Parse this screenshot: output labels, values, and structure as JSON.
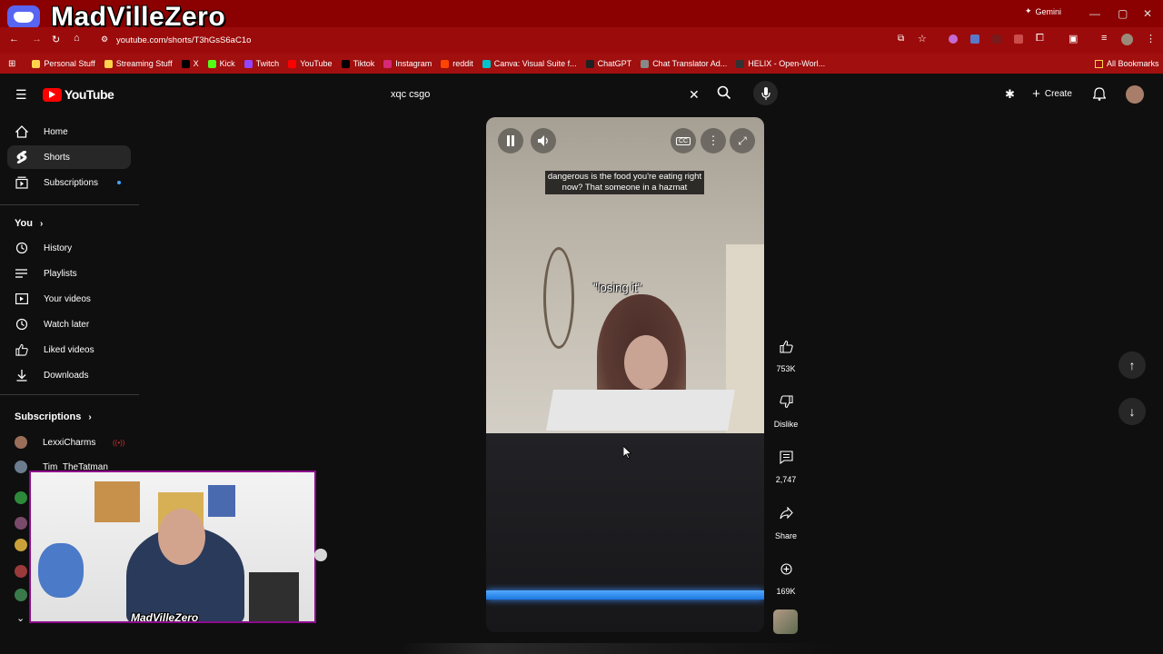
{
  "overlay": {
    "title": "MadVilleZero",
    "webcam_name": "MadVilleZero"
  },
  "browser": {
    "url": "youtube.com/shorts/T3hGsS6aC1o",
    "tab_hint": "bifr",
    "gemini_label": "Gemini",
    "bookmarks": [
      {
        "label": "Personal Stuff",
        "color": "#ffd44d"
      },
      {
        "label": "Streaming Stuff",
        "color": "#ffd44d"
      },
      {
        "label": "X",
        "color": "#000000"
      },
      {
        "label": "Kick",
        "color": "#53fc18"
      },
      {
        "label": "Twitch",
        "color": "#9146ff"
      },
      {
        "label": "YouTube",
        "color": "#ff0000"
      },
      {
        "label": "Tiktok",
        "color": "#000000"
      },
      {
        "label": "Instagram",
        "color": "#d62976"
      },
      {
        "label": "reddit",
        "color": "#ff4500"
      },
      {
        "label": "Canva: Visual Suite f...",
        "color": "#00c4cc"
      },
      {
        "label": "ChatGPT",
        "color": "#202123"
      },
      {
        "label": "Chat Translator Ad...",
        "color": "#888888"
      },
      {
        "label": "HELIX - Open-Worl...",
        "color": "#333333"
      }
    ],
    "all_bookmarks": "All Bookmarks"
  },
  "youtube": {
    "logo": "YouTube",
    "search": {
      "value": "xqc csgo"
    },
    "create_label": "Create",
    "sidebar": {
      "main": [
        {
          "label": "Home",
          "icon": "home-icon"
        },
        {
          "label": "Shorts",
          "icon": "shorts-icon"
        },
        {
          "label": "Subscriptions",
          "icon": "subscriptions-icon"
        }
      ],
      "you_heading": "You",
      "you": [
        {
          "label": "History",
          "icon": "history-icon"
        },
        {
          "label": "Playlists",
          "icon": "playlists-icon"
        },
        {
          "label": "Your videos",
          "icon": "your-videos-icon"
        },
        {
          "label": "Watch later",
          "icon": "watch-later-icon"
        },
        {
          "label": "Liked videos",
          "icon": "liked-videos-icon"
        },
        {
          "label": "Downloads",
          "icon": "downloads-icon"
        }
      ],
      "subscriptions_heading": "Subscriptions",
      "subscriptions": [
        {
          "label": "LexxiCharms",
          "color": "#9b6e5a"
        },
        {
          "label": "Tim_TheTatman",
          "color": "#6b7c8e"
        }
      ]
    },
    "short": {
      "caption_1": "dangerous is the food you're eating right now? That someone in a hazmat",
      "caption_2": "\"losing it\"",
      "likes": "753K",
      "dislike_label": "Dislike",
      "comments": "2,747",
      "share_label": "Share",
      "remixes": "169K"
    }
  }
}
